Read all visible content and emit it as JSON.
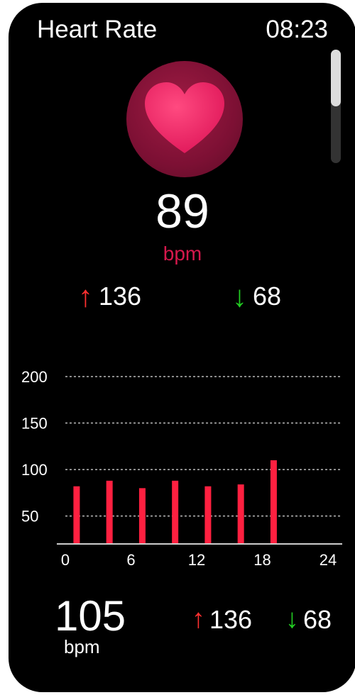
{
  "header": {
    "title": "Heart Rate",
    "time": "08:23"
  },
  "current": {
    "value": "89",
    "unit": "bpm"
  },
  "stats": {
    "max": "136",
    "min": "68"
  },
  "chart_data": {
    "type": "bar",
    "x": [
      1,
      4,
      7,
      10,
      13,
      16,
      19
    ],
    "values": [
      82,
      88,
      80,
      88,
      82,
      84,
      110
    ],
    "xticks": [
      "0",
      "6",
      "12",
      "18",
      "24"
    ],
    "yticks": [
      "50",
      "100",
      "150",
      "200"
    ],
    "xlim": [
      0,
      24
    ],
    "ylim": [
      20,
      200
    ],
    "grid": true,
    "colors": {
      "bar": "#ff2040",
      "grid": "#bbbbbb",
      "axis": "#cccccc",
      "text": "#ffffff"
    }
  },
  "footer": {
    "value": "105",
    "unit": "bpm",
    "max": "136",
    "min": "68"
  },
  "colors": {
    "background": "#000000",
    "accent": "#d6184c",
    "up": "#ff3030",
    "down": "#22cc22"
  }
}
